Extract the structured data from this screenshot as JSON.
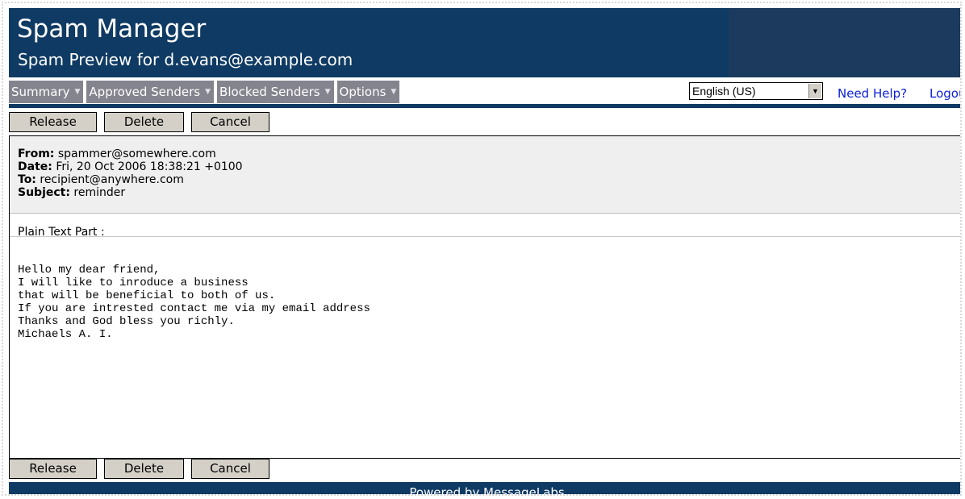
{
  "header": {
    "title": "Spam Manager",
    "subtitle": "Spam Preview for d.evans@example.com"
  },
  "nav": {
    "items": [
      {
        "label": "Summary"
      },
      {
        "label": "Approved Senders"
      },
      {
        "label": "Blocked Senders"
      },
      {
        "label": "Options"
      }
    ],
    "language": "English (US)",
    "help": "Need Help?",
    "logout": "Logout"
  },
  "actions": {
    "release": "Release",
    "delete": "Delete",
    "cancel": "Cancel"
  },
  "message": {
    "from_label": "From:",
    "from": "spammer@somewhere.com",
    "date_label": "Date:",
    "date": "Fri, 20 Oct 2006 18:38:21 +0100",
    "to_label": "To:",
    "to": "recipient@anywhere.com",
    "subject_label": "Subject:",
    "subject": "reminder",
    "part_label": "Plain Text Part :",
    "body": "Hello my dear friend,\nI will like to inroduce a business\nthat will be beneficial to both of us.\nIf you are intrested contact me via my email address\nThanks and God bless you richly.\nMichaels A. I."
  },
  "footer": {
    "text": "Powered by MessageLabs"
  },
  "colors": {
    "header_bg": "#0f3a63",
    "nav_bg": "#84848f",
    "link": "#0b1fd8",
    "headers_panel_bg": "#efefef",
    "button_bg": "#d4d0c8"
  }
}
